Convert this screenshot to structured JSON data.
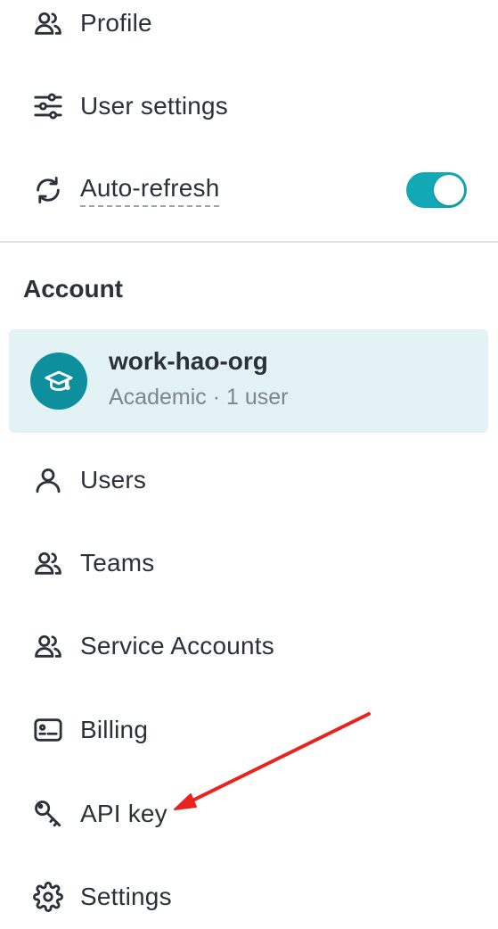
{
  "preferences": {
    "items": [
      {
        "label": "Profile",
        "icon": "users-icon"
      },
      {
        "label": "User settings",
        "icon": "sliders-icon"
      },
      {
        "label": "Auto-refresh",
        "icon": "refresh-icon",
        "toggle": true
      }
    ],
    "toggle_color": "#13a8b5"
  },
  "account": {
    "section_title": "Account",
    "org_name": "work-hao-org",
    "org_plan": "Academic",
    "org_separator": "·",
    "org_users": "1 user",
    "org_subtitle": "Academic · 1 user",
    "avatar_icon": "graduation-cap-icon",
    "avatar_color": "#0e8f9e",
    "card_color": "#e3f2f5"
  },
  "nav": {
    "items": [
      {
        "label": "Users",
        "icon": "user-icon"
      },
      {
        "label": "Teams",
        "icon": "users-icon"
      },
      {
        "label": "Service Accounts",
        "icon": "users-icon"
      },
      {
        "label": "Billing",
        "icon": "id-card-icon"
      },
      {
        "label": "API key",
        "icon": "key-icon"
      },
      {
        "label": "Settings",
        "icon": "gear-icon"
      }
    ]
  },
  "annotation": {
    "arrow_color": "#e8231f",
    "points_to": "API key"
  }
}
